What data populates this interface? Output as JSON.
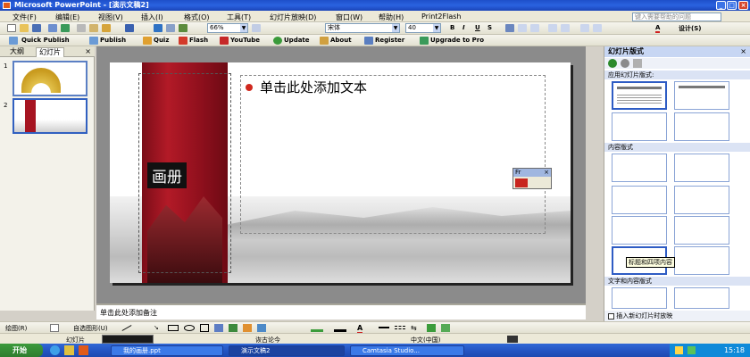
{
  "window": {
    "title": "Microsoft PowerPoint - [演示文稿2]"
  },
  "menu": {
    "items": [
      "文件(F)",
      "编辑(E)",
      "视图(V)",
      "插入(I)",
      "格式(O)",
      "工具(T)",
      "幻灯片放映(D)",
      "窗口(W)",
      "帮助(H)",
      "Print2Flash"
    ],
    "help_placeholder": "键入需要帮助的问题"
  },
  "toolbar1": {
    "zoom": "66%",
    "font": "宋体",
    "size": "40",
    "design": "设计(S)"
  },
  "toolbar2": {
    "items": [
      "Quick Publish",
      "Publish",
      "Quiz",
      "Flash",
      "YouTube",
      "Update",
      "About",
      "Register",
      "Upgrade to Pro"
    ]
  },
  "outline": {
    "tabs": [
      "大纲",
      "幻灯片"
    ],
    "slides": [
      "1",
      "2"
    ]
  },
  "slide": {
    "title_placeholder": "单击此处添加文本",
    "vertical_title": "画册"
  },
  "floating": {
    "label": "Fr"
  },
  "notes": {
    "placeholder": "单击此处添加备注"
  },
  "taskpane": {
    "title": "幻灯片版式",
    "section_applied": "应用幻灯片版式:",
    "section_content": "内容版式",
    "section_text_content": "文字和内容版式",
    "tooltip": "标题和四项内容",
    "footer": "插入新幻灯片时放映"
  },
  "drawbar": {
    "draw": "绘图(R)",
    "autoshapes": "自选图形(U)"
  },
  "status": {
    "slide": "幻灯片",
    "design_name": "诙古论今",
    "language": "中文(中国)"
  },
  "taskbar": {
    "start": "开始",
    "items": [
      "我的画册.ppt",
      "演示文稿2",
      "Camtasia Studio..."
    ],
    "clock": "15:18"
  }
}
